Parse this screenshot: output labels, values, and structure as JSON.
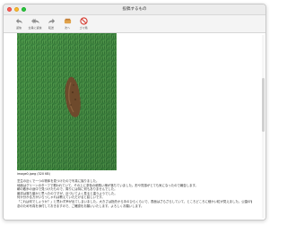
{
  "window": {
    "title": "投稿するもの"
  },
  "toolbar": {
    "items": [
      {
        "label": "返信",
        "icon": "reply-icon"
      },
      {
        "label": "全員に返信",
        "icon": "reply-all-icon"
      },
      {
        "label": "転送",
        "icon": "forward-icon"
      },
      {
        "label": "次へ",
        "icon": "next-icon"
      },
      {
        "label": "ゴミ箱",
        "icon": "trash-icon"
      }
    ]
  },
  "message": {
    "image_caption": "image0.jpeg (320 KB)",
    "body_lines": [
      "芝生の近くで一つの物体を見つけたので写真に撮りました。",
      "地面はグリーンのターフで覆われていて、その上に茶色の細長い塊が落ちていました。形や質感がとても気になったので報告します。",
      "朝の散歩の途中で見つけたもので、周りには特に何もありませんでした。",
      "最初は落ち葉かと思ったのですが、近づいてよく見ると違うようでした。",
      "何か分かる方がいらっしゃれば教えていただけると嬉しいです。",
      "「これは何でしょうか？」と思わず声が出てしまいました。大きさは指先から手のひらくらいで、表面はざらざらしていて、ところどころに細かい粒が見えました。公園の管理の方にも連絡しようかと考えています。",
      "念のため写真を添付しておきますので、ご確認をお願いいたします。よろしくお願いします。"
    ]
  },
  "colors": {
    "grass_dark": "#2f7a36",
    "grass_light": "#5fae56",
    "object_brown": "#7a5433"
  }
}
